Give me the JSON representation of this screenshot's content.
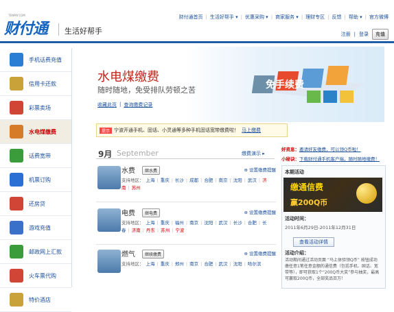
{
  "header": {
    "logo_text": "财付通",
    "logo_small": "TENPAY.COM",
    "slogan": "生活好帮手",
    "topnav": [
      "财付通首页",
      "生活好帮手 ▾",
      "优惠采购 ▾",
      "商家服务 ▾",
      "理财专区",
      "反馈",
      "帮助 ▾",
      "官方微博"
    ],
    "login": "注册",
    "register": "登录",
    "recharge": "充值"
  },
  "sidebar": {
    "items": [
      {
        "label": "手机话费充值",
        "icon": "phone-icon",
        "color": "#2a7fd4"
      },
      {
        "label": "信用卡还款",
        "icon": "creditcard-icon",
        "color": "#c9a23a"
      },
      {
        "label": "彩票卖场",
        "icon": "lottery-icon",
        "color": "#d04535"
      },
      {
        "label": "水电煤缴费",
        "icon": "utility-icon",
        "color": "#d67c28",
        "active": true
      },
      {
        "label": "话费宽带",
        "icon": "broadband-icon",
        "color": "#3a9c3a"
      },
      {
        "label": "机票订购",
        "icon": "plane-icon",
        "color": "#2a6fd4"
      },
      {
        "label": "还房贷",
        "icon": "house-icon",
        "color": "#d04535"
      },
      {
        "label": "游戏充值",
        "icon": "game-icon",
        "color": "#3a70c9"
      },
      {
        "label": "邮政网上汇款",
        "icon": "post-icon",
        "color": "#3a9c3a"
      },
      {
        "label": "火车票代购",
        "icon": "train-icon",
        "color": "#d04535"
      },
      {
        "label": "特价酒店",
        "icon": "hotel-icon",
        "color": "#c9a23a"
      }
    ]
  },
  "banner": {
    "title": "水电煤缴费",
    "subtitle": "随时随地，免受排队劳顿之苦",
    "link1": "收藏此页",
    "link_sep": "|",
    "link2": "查询缴费记录",
    "art_text": "免手续费"
  },
  "notice": {
    "tag": "提示",
    "text": "宁波开通手机、固话、小灵通等多种手机固话宽带缴费啦！",
    "link": "马上缴费"
  },
  "month": {
    "cn": "9月",
    "en": "September",
    "demo": "缴费演示"
  },
  "bills": [
    {
      "name": "水费",
      "button": "继水费",
      "reminder": "设置缴费提醒",
      "label": "支持地区：",
      "regions": [
        "上海",
        "重庆",
        "长沙",
        "成都",
        "合肥",
        "南京",
        "沈阳",
        "武汉",
        "济南",
        "苏州"
      ],
      "red": [
        8,
        9
      ]
    },
    {
      "name": "电费",
      "button": "继电费",
      "reminder": "设置缴费提醒",
      "label": "支持地区：",
      "regions": [
        "上海",
        "重庆",
        "福州",
        "南京",
        "沈阳",
        "武汉",
        "长沙",
        "合肥",
        "长春",
        "济南",
        "丹东",
        "苏州",
        "宁波"
      ],
      "red": [
        9,
        10,
        11,
        12
      ]
    },
    {
      "name": "燃气",
      "button": "继续缴费",
      "reminder": "设置缴费提醒",
      "label": "支持地区：",
      "regions": [
        "上海",
        "重庆",
        "郑州",
        "南京",
        "合肥",
        "武汉",
        "沈阳",
        "哈尔滨"
      ],
      "red": []
    }
  ],
  "right": {
    "friend_label": "好资息：",
    "friend_link": "邀请好友缴费，可以领Q币啦！",
    "tip_label": "小秘诀：",
    "tip_link": "下载财付通手机客户端，随时随地缴费！"
  },
  "activity": {
    "title": "本期活动",
    "banner_line1": "缴通信费",
    "banner_line2": "赢200Q币",
    "time_label": "活动时间：",
    "time": "2011年6月29日-2011年12月31日",
    "button": "查看活动详情",
    "intro_label": "活动介绍：",
    "intro": "活动期间通过活动页面 “马上体验领Q币” 按钮成功缴任意1笔任意金额的通信费（包括手机、固话、宽带等），即可获取1个“200Q币大奖”参与抽奖，最高可赢取200Q币，全部奖品百万！"
  }
}
